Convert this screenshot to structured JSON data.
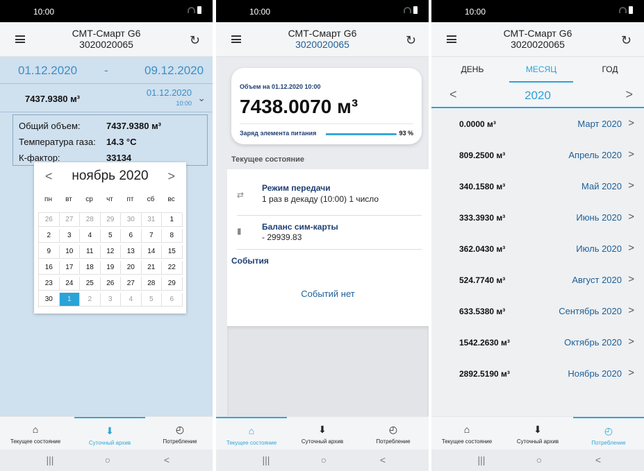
{
  "common": {
    "time": "10:00",
    "app_title": "СМТ-Смарт G6",
    "serial": "3020020065"
  },
  "nav": {
    "items": [
      "Текущее состояние",
      "Суточный архив",
      "Потребление"
    ]
  },
  "screen1": {
    "date_from": "01.12.2020",
    "dash": "-",
    "date_to": "09.12.2020",
    "value": "7437.9380 м³",
    "date": "01.12.2020",
    "time": "10:00",
    "info": [
      {
        "label": "Общий объем:",
        "value": "7437.9380 м³"
      },
      {
        "label": "Температура газа:",
        "value": "14.3 °С"
      },
      {
        "label": "К-фактор:",
        "value": "33134"
      }
    ],
    "calendar": {
      "month": "ноябрь 2020",
      "dows": [
        "пн",
        "вт",
        "ср",
        "чт",
        "пт",
        "сб",
        "вс"
      ],
      "rows": [
        [
          "26",
          "27",
          "28",
          "29",
          "30",
          "31",
          "1"
        ],
        [
          "2",
          "3",
          "4",
          "5",
          "6",
          "7",
          "8"
        ],
        [
          "9",
          "10",
          "11",
          "12",
          "13",
          "14",
          "15"
        ],
        [
          "16",
          "17",
          "18",
          "19",
          "20",
          "21",
          "22"
        ],
        [
          "23",
          "24",
          "25",
          "26",
          "27",
          "28",
          "29"
        ],
        [
          "30",
          "1",
          "2",
          "3",
          "4",
          "5",
          "6"
        ]
      ]
    }
  },
  "screen2": {
    "card_caption": "Объем на 01.12.2020 10:00",
    "card_value": "7438.0070 м³",
    "battery_label": "Заряд элемента питания",
    "battery_pct": "93 %",
    "battery_fraction": 0.93,
    "state_title": "Текущее состояние",
    "mode_title": "Режим передачи",
    "mode_value": "1 раз в декаду (10:00) 1 число",
    "sim_title": "Баланс сим-карты",
    "sim_value": "- 29939.83",
    "events_title": "События",
    "events_none": "Событий нет"
  },
  "screen3": {
    "tabs": [
      "ДЕНЬ",
      "МЕСЯЦ",
      "ГОД"
    ],
    "year": "2020",
    "rows": [
      {
        "value": "0.0000 м³",
        "month": "Март 2020"
      },
      {
        "value": "809.2500 м³",
        "month": "Апрель 2020"
      },
      {
        "value": "340.1580 м³",
        "month": "Май 2020"
      },
      {
        "value": "333.3930 м³",
        "month": "Июнь 2020"
      },
      {
        "value": "362.0430 м³",
        "month": "Июль 2020"
      },
      {
        "value": "524.7740 м³",
        "month": "Август 2020"
      },
      {
        "value": "633.5380 м³",
        "month": "Сентябрь 2020"
      },
      {
        "value": "1542.2630 м³",
        "month": "Октябрь 2020"
      },
      {
        "value": "2892.5190 м³",
        "month": "Ноябрь 2020"
      }
    ]
  }
}
